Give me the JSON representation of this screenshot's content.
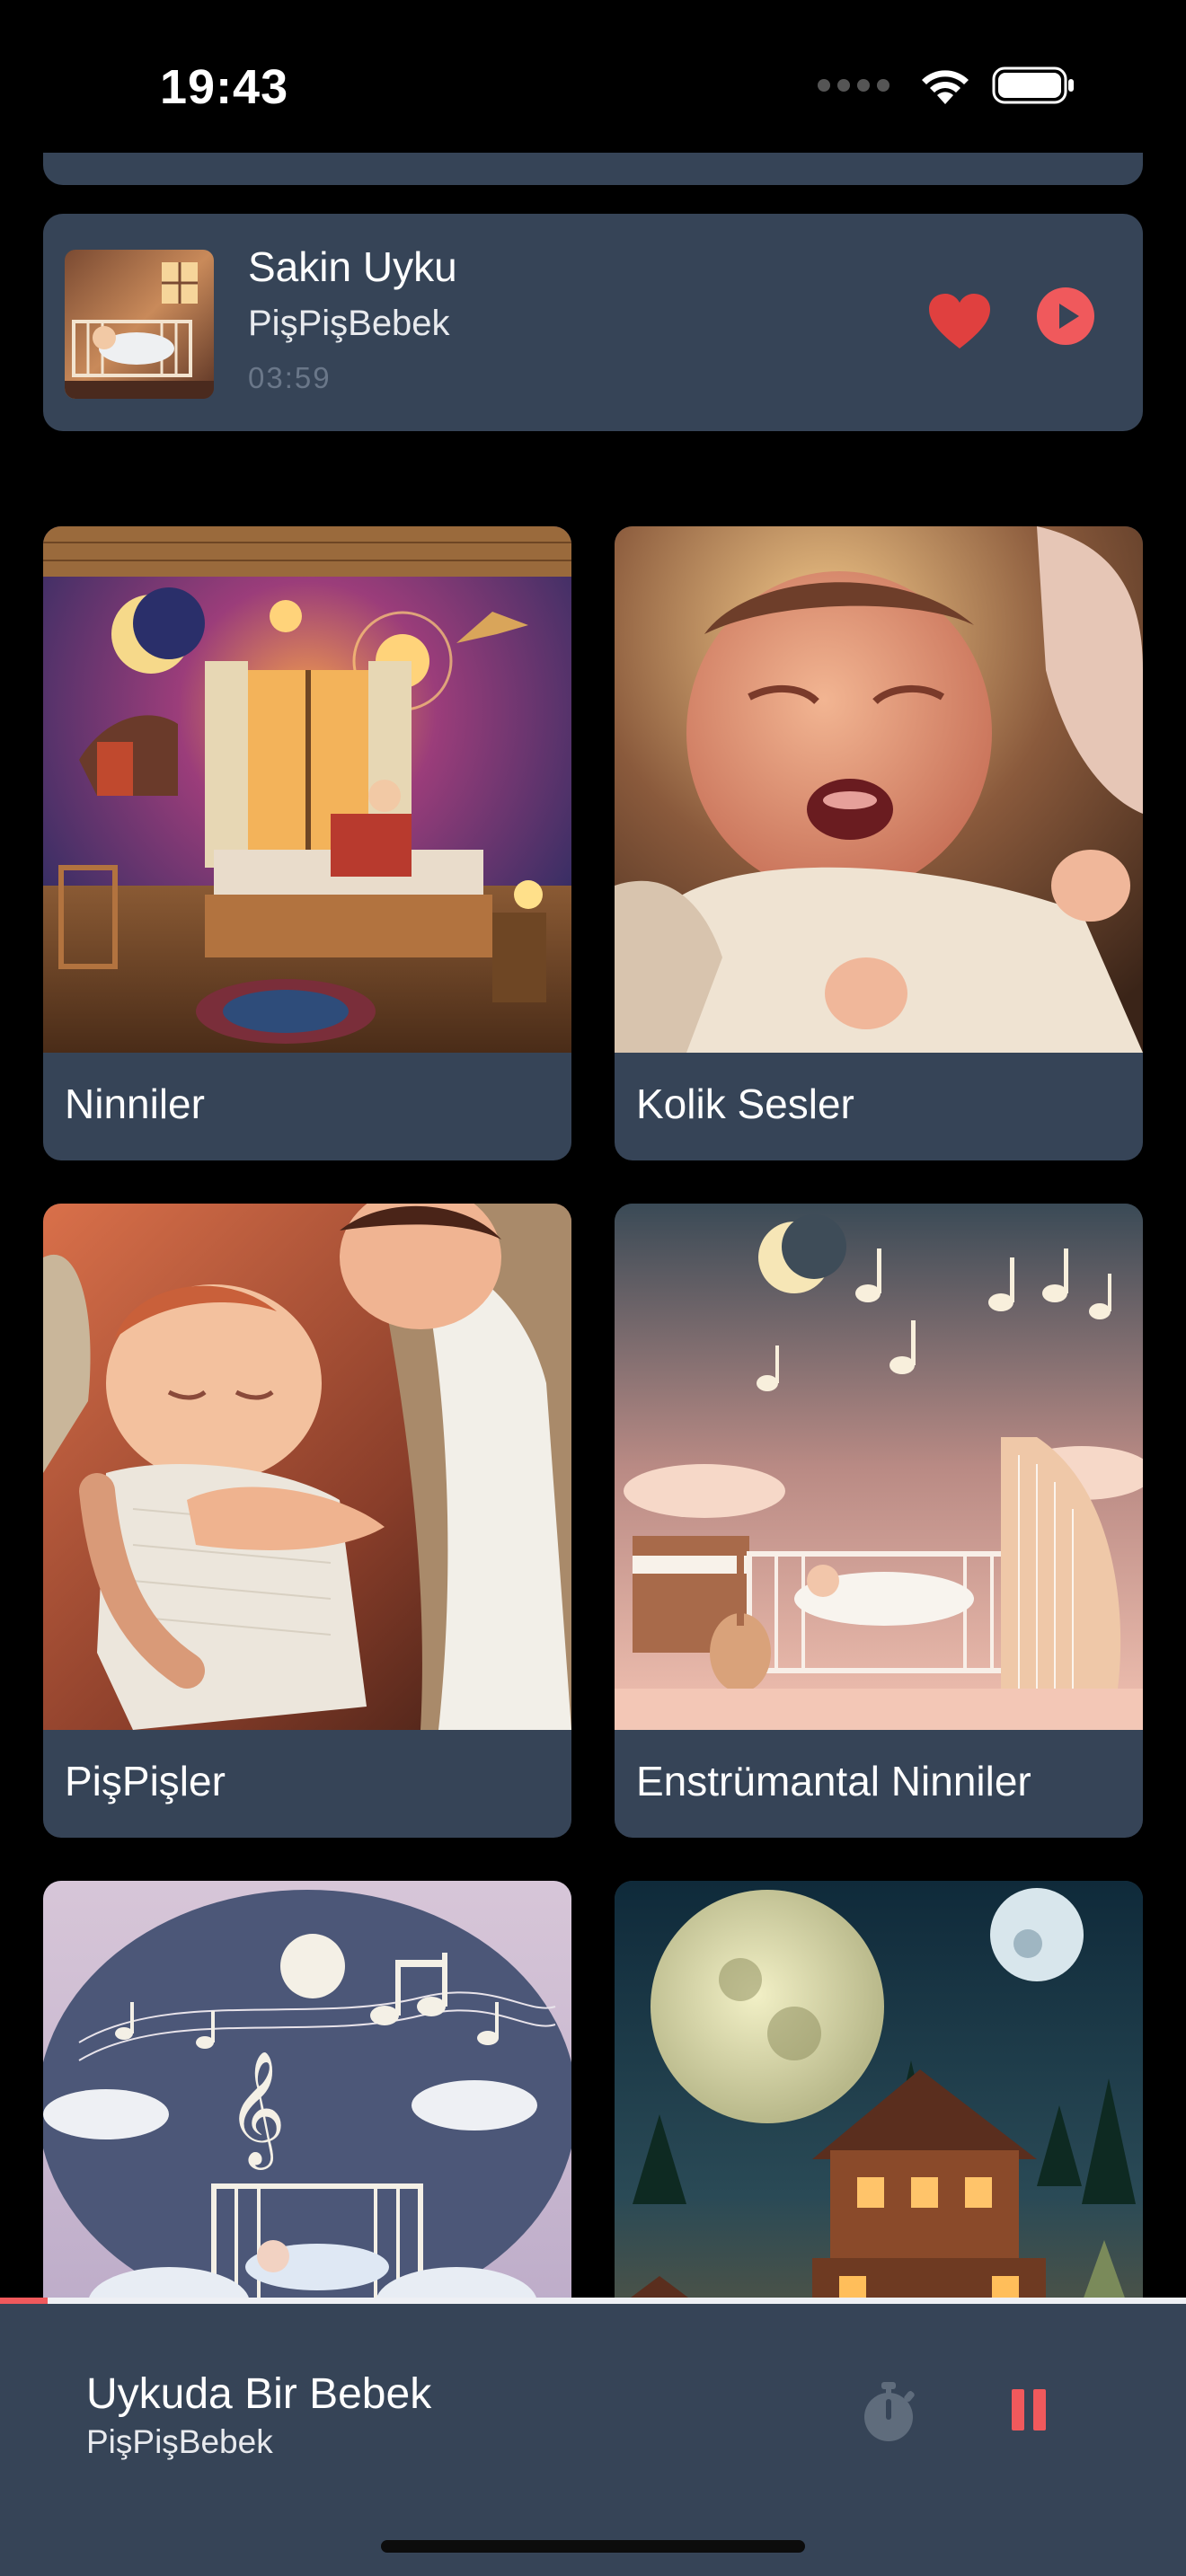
{
  "status_bar": {
    "time": "19:43",
    "icons": [
      "signal-dots-icon",
      "wifi-icon",
      "battery-icon"
    ]
  },
  "featured_track": {
    "title": "Sakin Uyku",
    "artist": "PişPişBebek",
    "duration": "03:59",
    "favorite_icon": "heart-icon",
    "play_icon": "play-circle-icon",
    "thumbnail": "baby-in-crib-image"
  },
  "categories": [
    {
      "label": "Ninniler",
      "image": "lullaby-room-night-image"
    },
    {
      "label": "Kolik Sesler",
      "image": "crying-baby-image"
    },
    {
      "label": "PişPişler",
      "image": "mother-soothing-baby-image"
    },
    {
      "label": "Enstrümantal Ninniler",
      "image": "instruments-music-notes-image"
    },
    {
      "label": "",
      "image": "moon-music-notes-crib-image"
    },
    {
      "label": "",
      "image": "moon-cabin-night-image"
    }
  ],
  "mini_player": {
    "title": "Uykuda Bir Bebek",
    "artist": "PişPişBebek",
    "progress": 0.04,
    "timer_icon": "stopwatch-icon",
    "pause_icon": "pause-icon"
  },
  "colors": {
    "card": "#364457",
    "accent": "#f0595c",
    "heart": "#e0403f",
    "background": "#000000"
  }
}
